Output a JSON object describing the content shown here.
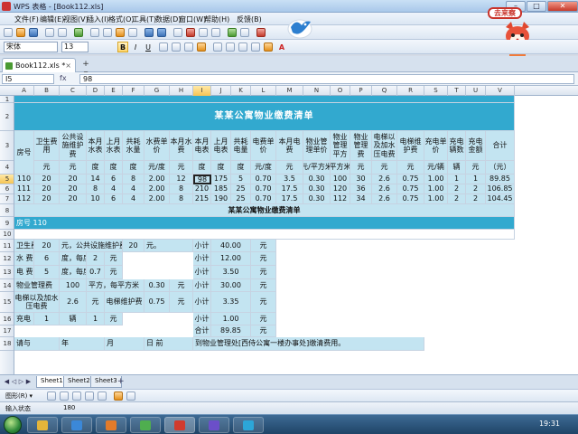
{
  "app": {
    "title": "WPS 表格 - [Book112.xls]",
    "win_min": "–",
    "win_max": "□",
    "win_close": "✕",
    "brand_tip": "去来察"
  },
  "menu": [
    "文件(F)",
    "编辑(E)",
    "视图(V)",
    "插入(I)",
    "格式(O)",
    "工具(T)",
    "数据(D)",
    "窗口(W)",
    "帮助(H)",
    "反馈(B)"
  ],
  "format_bar": {
    "font_name": "宋体",
    "font_size": "13",
    "bold": "B",
    "italic": "I",
    "underline": "U",
    "font_color": "A"
  },
  "tab": {
    "file_name": "Book112.xls *",
    "close": "×",
    "new_tab": "+ ▾"
  },
  "formula_bar": {
    "cell_ref": "I5",
    "fx": "fx",
    "value": "98"
  },
  "columns": [
    "A",
    "B",
    "C",
    "D",
    "E",
    "F",
    "G",
    "H",
    "I",
    "J",
    "K",
    "L",
    "M",
    "N",
    "O",
    "P",
    "Q",
    "R",
    "S",
    "T",
    "U",
    "V"
  ],
  "selected_column": "I",
  "rows": [
    "1",
    "2",
    "3",
    "4",
    "5",
    "6",
    "7",
    "8",
    "9",
    "10",
    "11",
    "12",
    "13",
    "14",
    "15",
    "16",
    "17",
    "18"
  ],
  "selected_row": "5",
  "sheet": {
    "title": "某某公寓物业缴费清单",
    "header_row1": [
      "房号",
      "卫生费用",
      "公共设施维护费",
      "本月水表",
      "上月水表",
      "共耗水量",
      "水费单价",
      "本月水费",
      "本月电表",
      "上月电表",
      "共耗电量",
      "电费单价",
      "本月电费",
      "物业管理单价",
      "物业管理平方",
      "物业管理费",
      "电梯以及加水压电费",
      "电梯维护费",
      "充电单价",
      "充电辆数",
      "充电金额",
      "合计"
    ],
    "header_row2": [
      "",
      "元",
      "元",
      "度",
      "度",
      "度",
      "元/度",
      "元",
      "度",
      "度",
      "度",
      "元/度",
      "元",
      "元/平方米",
      "平方米",
      "元",
      "元",
      "元",
      "元/辆",
      "辆",
      "元",
      "（元）"
    ],
    "data_rows": [
      [
        "110",
        "20",
        "20",
        "14",
        "6",
        "8",
        "2.00",
        "12",
        "98",
        "175",
        "5",
        "0.70",
        "3.5",
        "0.30",
        "100",
        "30",
        "2.6",
        "0.75",
        "1.00",
        "1",
        "1",
        "89.85"
      ],
      [
        "111",
        "20",
        "20",
        "8",
        "4",
        "4",
        "2.00",
        "8",
        "210",
        "185",
        "25",
        "0.70",
        "17.5",
        "0.30",
        "120",
        "36",
        "2.6",
        "0.75",
        "1.00",
        "2",
        "2",
        "106.85"
      ],
      [
        "112",
        "20",
        "20",
        "10",
        "6",
        "4",
        "2.00",
        "8",
        "215",
        "190",
        "25",
        "0.70",
        "17.5",
        "0.30",
        "112",
        "34",
        "2.6",
        "0.75",
        "1.00",
        "2",
        "2",
        "104.45"
      ]
    ],
    "subtitle": "某某公寓物业缴费清单",
    "room_label": "房号 110",
    "detail": {
      "r11": [
        "卫生费",
        "20",
        "元，公共设施维护费",
        "20",
        "元。",
        "小计",
        "40.00",
        "元"
      ],
      "r12": [
        "水 费",
        "6",
        "度，每度",
        "2",
        "元",
        "小计",
        "12.00",
        "元"
      ],
      "r13": [
        "电 费",
        "5",
        "度，每度",
        "0.7",
        "元",
        "小计",
        "3.50",
        "元"
      ],
      "r14": [
        "物业管理费",
        "100",
        "平方，每平方米",
        "0.30",
        "元",
        "小计",
        "30.00",
        "元"
      ],
      "r15": [
        "电梯以及加水压电费",
        "2.6",
        "元",
        "电梯维护费",
        "0.75",
        "元",
        "小计",
        "3.35",
        "元"
      ],
      "r16": [
        "充电",
        "1",
        "辆",
        "1",
        "元",
        "小计",
        "1.00",
        "元"
      ],
      "r17": [
        "合计",
        "89.85",
        "元"
      ],
      "r18": [
        "请与",
        "年",
        "月",
        "日 前",
        "到物业管理处[西侍公寓一楼办事处]缴清费用。"
      ]
    }
  },
  "sheet_tabs": [
    "Sheet1",
    "Sheet2",
    "Sheet3"
  ],
  "active_sheet": "Sheet1",
  "add_sheet": "+",
  "sheet_nav": [
    "◀",
    "◁",
    "▷",
    "▶"
  ],
  "draw_bar": {
    "label": "图形(R) ▾"
  },
  "status": {
    "mode": "输入状态",
    "value": "180"
  },
  "taskbar": {
    "clock": "19:31"
  },
  "colors": {
    "header_fill": "#32a9cf",
    "light_fill": "#c3e4f1",
    "window_chrome": "#c9e0f5"
  }
}
